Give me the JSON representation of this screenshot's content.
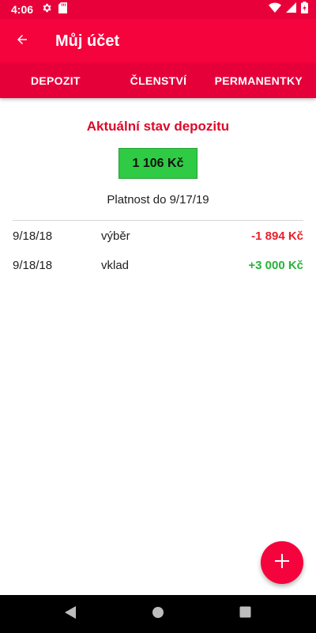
{
  "status_bar": {
    "time": "4:06"
  },
  "app_bar": {
    "title": "Můj účet"
  },
  "tabs": [
    {
      "label": "DEPOZIT"
    },
    {
      "label": "ČLENSTVÍ"
    },
    {
      "label": "PERMANENTKY"
    }
  ],
  "deposit": {
    "title": "Aktuální stav depozitu",
    "balance": "1 106 Kč",
    "validity": "Platnost do 9/17/19"
  },
  "transactions": [
    {
      "date": "9/18/18",
      "type": "výběr",
      "amount": "-1 894 Kč"
    },
    {
      "date": "9/18/18",
      "type": "vklad",
      "amount": "+3 000 Kč"
    }
  ],
  "colors": {
    "primary": "#f5033d",
    "balance_bg": "#2fcb45",
    "negative": "#e8202a",
    "positive": "#26b33a"
  },
  "icons": {
    "status": [
      "gear-icon",
      "sd-card-icon",
      "wifi-icon",
      "signal-icon",
      "battery-icon"
    ],
    "app_bar": "arrow-back-icon",
    "fab": "plus-icon",
    "nav": [
      "nav-back-icon",
      "nav-home-icon",
      "nav-recents-icon"
    ]
  }
}
